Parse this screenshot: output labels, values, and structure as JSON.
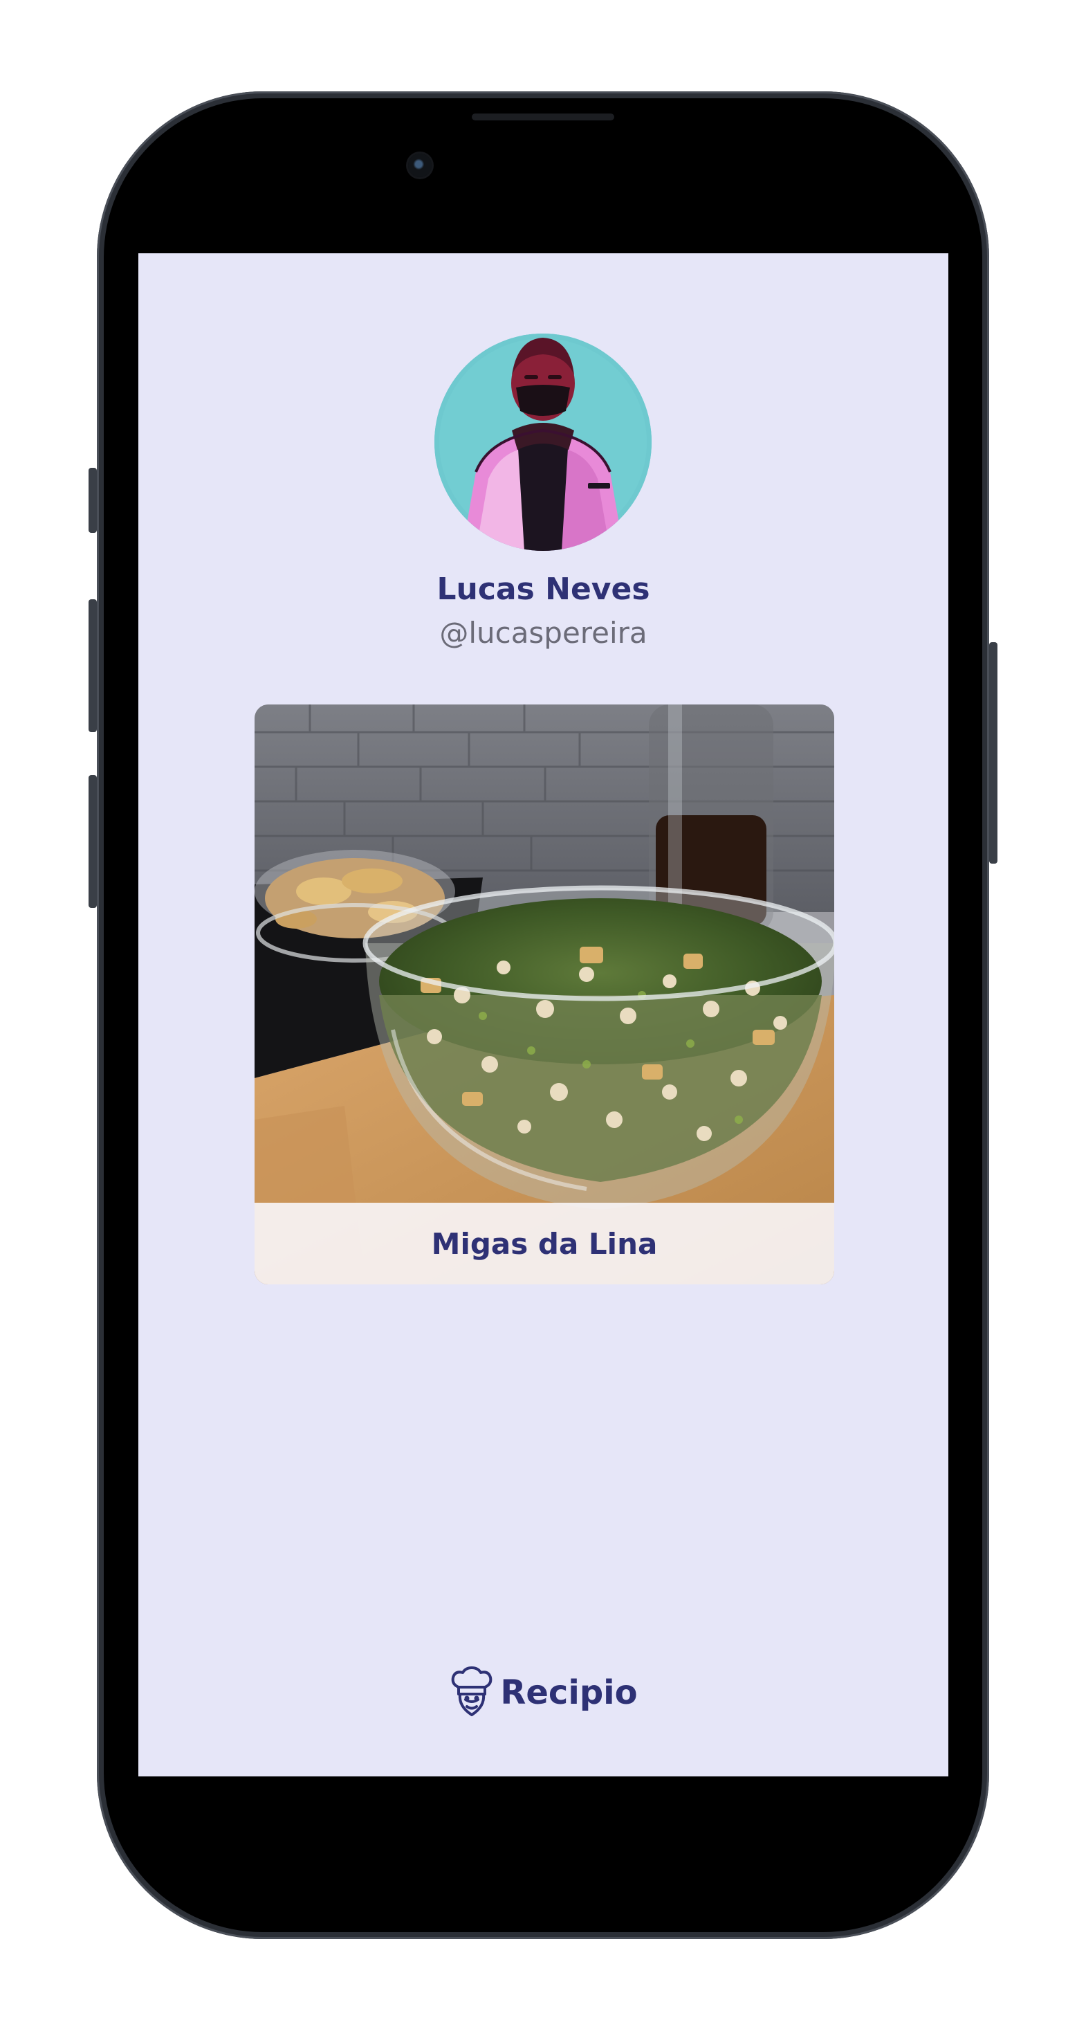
{
  "profile": {
    "name": "Lucas Neves",
    "handle": "@lucaspereira"
  },
  "recipes": [
    {
      "title": "Migas da Lina"
    }
  ],
  "brand": {
    "name": "Recipio"
  },
  "colors": {
    "screen_background": "#e6e6f8",
    "accent": "#2e3175",
    "secondary_text": "#6b6b78"
  },
  "icons": {
    "brand_logo": "chef-hat-icon"
  }
}
